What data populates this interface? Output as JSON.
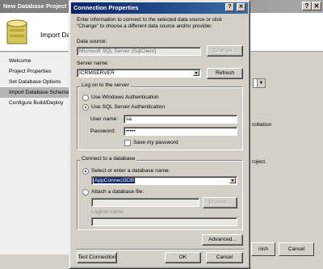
{
  "background_window": {
    "title": "New Database Project W",
    "header_text": "Import Dat",
    "nav": [
      "Welcome",
      "Project Properties",
      "Set Database Options",
      "Import Database Schema",
      "Configure Build/Deploy"
    ],
    "right_texts": [
      "collation",
      "roject."
    ],
    "finish_label": "nish",
    "cancel_label": "Cancel",
    "close_glyph": "✕",
    "help_glyph": "?"
  },
  "dialog": {
    "title": "Connection Properties",
    "help_glyph": "?",
    "close_glyph": "✕",
    "intro": "Enter information to connect to the selected data source or click \"Change\" to choose a different data source and/or provider.",
    "data_source": {
      "label": "Data source:",
      "value": "Microsoft SQL Server (SqlClient)",
      "change_label": "Change..."
    },
    "server": {
      "label": "Server name:",
      "value": "ICRMSERVER",
      "refresh_label": "Refresh"
    },
    "logon": {
      "group_label": "Log on to the server",
      "windows_auth": "Use Windows Authentication",
      "sql_auth": "Use SQL Server Authentication",
      "user_label": "User name:",
      "user_value": "sa",
      "password_label": "Password:",
      "password_value": "•••••",
      "save_password": "Save my password"
    },
    "database": {
      "group_label": "Connect to a database",
      "select_label": "Select or enter a database name:",
      "db_value": "AppConnect3DB",
      "attach_label": "Attach a database file:",
      "browse_label": "Browse...",
      "logical_label": "Logical name:"
    },
    "advanced_label": "Advanced...",
    "test_label": "Test Connection",
    "ok_label": "OK",
    "cancel_label": "Cancel"
  }
}
